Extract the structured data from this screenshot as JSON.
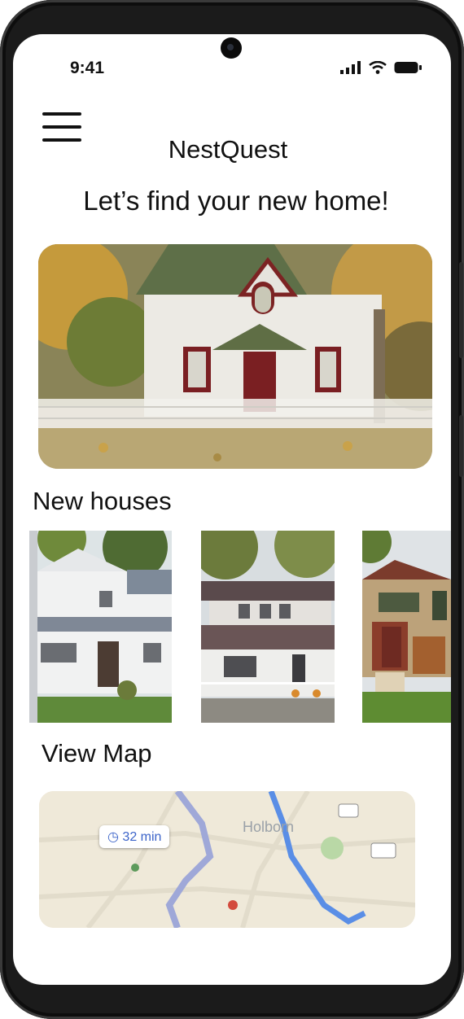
{
  "status": {
    "time": "9:41"
  },
  "app": {
    "title": "NestQuest"
  },
  "headline": "Let’s find your new home!",
  "sections": {
    "new_houses": "New houses",
    "view_map": "View Map"
  },
  "map": {
    "duration": "32 min",
    "place": "Holborn"
  }
}
